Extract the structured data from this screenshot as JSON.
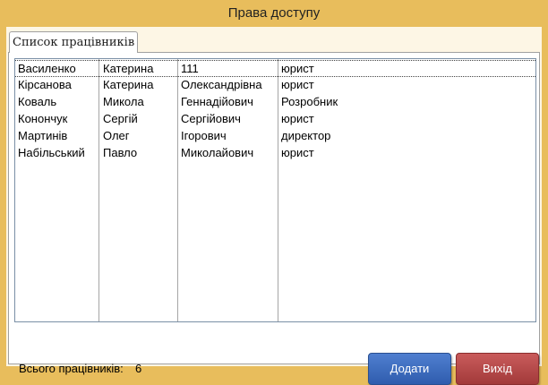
{
  "window": {
    "title": "Права доступу"
  },
  "tab": {
    "label": "Список працівників"
  },
  "employees": [
    [
      "Василенко",
      "Катерина",
      "111",
      "юрист"
    ],
    [
      "Кірсанова",
      "Катерина",
      "Олександрівна",
      "юрист"
    ],
    [
      "Коваль",
      "Микола",
      "Геннадійович",
      "Розробник"
    ],
    [
      "Конончук",
      "Сергій",
      "Сергійович",
      "юрист"
    ],
    [
      "Мартинів",
      "Олег",
      "Ігорович",
      "директор"
    ],
    [
      "Набільський",
      "Павло",
      "Миколайович",
      "юрист"
    ]
  ],
  "footer": {
    "total_label": "Всього працівників:",
    "total_value": "6",
    "add_label": "Додати",
    "exit_label": "Вихід"
  },
  "colors": {
    "window_background": "#e8bd5c",
    "add_button": "#3a6abf",
    "exit_button": "#b84848"
  }
}
